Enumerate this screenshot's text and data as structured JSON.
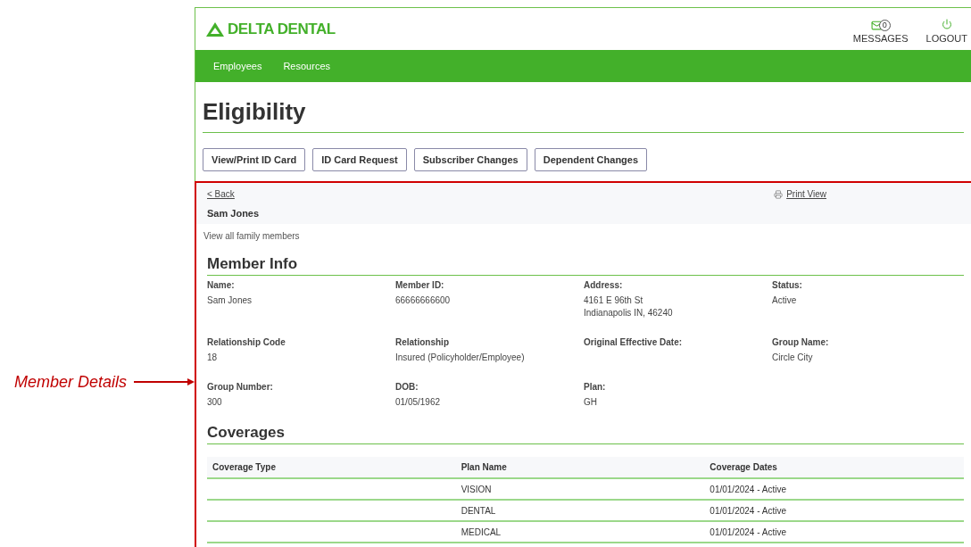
{
  "annotation": {
    "label": "Member Details"
  },
  "header": {
    "logo": "DELTA DENTAL",
    "messages": {
      "count": "0",
      "label": "MESSAGES"
    },
    "logout": "LOGOUT"
  },
  "nav": [
    "Employees",
    "Resources"
  ],
  "page_title": "Eligibility",
  "actions": [
    "View/Print ID Card",
    "ID Card Request",
    "Subscriber Changes",
    "Dependent Changes"
  ],
  "member_panel": {
    "back": "< Back",
    "print_view": "Print View",
    "member_name": "Sam Jones",
    "family_link": "View all family members"
  },
  "member_info": {
    "title": "Member Info",
    "fields": [
      {
        "label": "Name:",
        "value": [
          "Sam Jones"
        ]
      },
      {
        "label": "Member ID:",
        "value": [
          "66666666600"
        ]
      },
      {
        "label": "Address:",
        "value": [
          "4161 E 96th St",
          "Indianapolis IN, 46240"
        ]
      },
      {
        "label": "Status:",
        "value": [
          "Active"
        ]
      },
      {
        "label": "Relationship Code",
        "value": [
          "18"
        ]
      },
      {
        "label": "Relationship",
        "value": [
          "Insured (Policyholder/Employee)"
        ]
      },
      {
        "label": "Original Effective Date:"
      },
      {
        "label": "Group Name:",
        "value": [
          "Circle City"
        ]
      },
      {
        "label": "Group Number:",
        "value": [
          "300"
        ]
      },
      {
        "label": "DOB:",
        "value": [
          "01/05/1962"
        ]
      },
      {
        "label": "Plan:",
        "value": [
          "GH"
        ]
      }
    ]
  },
  "coverages": {
    "title": "Coverages",
    "columns": [
      "Coverage Type",
      "Plan Name",
      "Coverage Dates"
    ],
    "rows": [
      [
        "",
        "VISION",
        "01/01/2024 - Active"
      ],
      [
        "",
        "DENTAL",
        "01/01/2024 - Active"
      ],
      [
        "",
        "MEDICAL",
        "01/01/2024 - Active"
      ]
    ]
  }
}
